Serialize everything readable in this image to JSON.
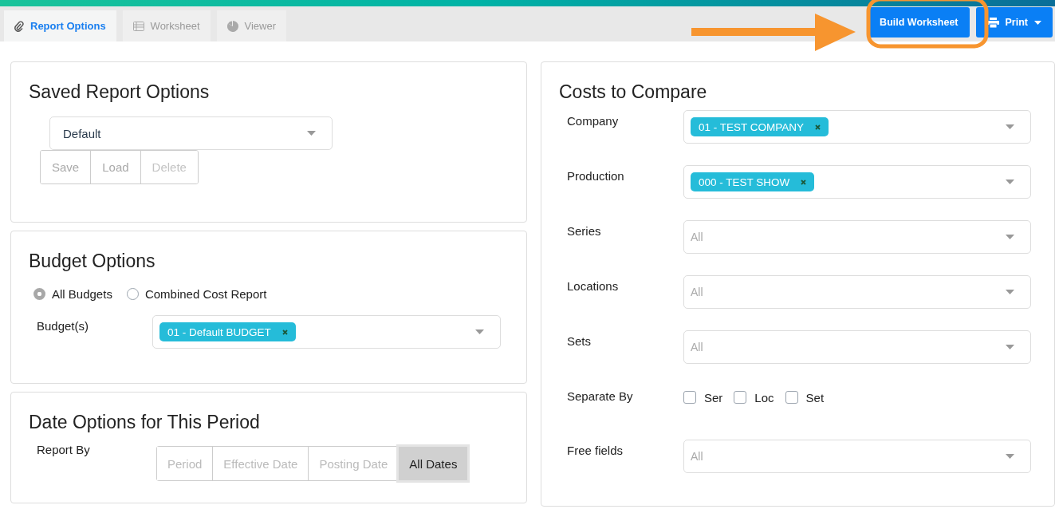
{
  "tabs": [
    {
      "label": "Report Options",
      "selected": true
    },
    {
      "label": "Worksheet",
      "selected": false
    },
    {
      "label": "Viewer",
      "selected": false
    }
  ],
  "toolbar": {
    "build_button": "Build Worksheet",
    "print_button": "Print"
  },
  "saved_report_options": {
    "title": "Saved Report Options",
    "select_value": "Default",
    "buttons": [
      {
        "label": "Save",
        "disabled": false
      },
      {
        "label": "Load",
        "disabled": false
      },
      {
        "label": "Delete",
        "disabled": true
      }
    ]
  },
  "budget_options": {
    "title": "Budget Options",
    "radios": [
      {
        "label": "All Budgets",
        "selected": true
      },
      {
        "label": "Combined Cost Report",
        "selected": false
      }
    ],
    "field": {
      "label": "Budget(s)",
      "tags": [
        "01 - Default BUDGET"
      ]
    }
  },
  "date_options": {
    "title": "Date Options for This Period",
    "field": {
      "label": "Report By",
      "segments": [
        {
          "label": "Period",
          "selected": false
        },
        {
          "label": "Effective Date",
          "selected": false
        },
        {
          "label": "Posting Date",
          "selected": false
        },
        {
          "label": "All Dates",
          "selected": true
        }
      ]
    }
  },
  "costs_to_compare": {
    "title": "Costs to Compare",
    "fields": [
      {
        "kind": "select",
        "label": "Company",
        "tags": [
          "01 - TEST COMPANY"
        ]
      },
      {
        "kind": "select",
        "label": "Production",
        "tags": [
          "000 - TEST SHOW"
        ]
      },
      {
        "kind": "select",
        "label": "Series",
        "placeholder": "All"
      },
      {
        "kind": "select",
        "label": "Locations",
        "placeholder": "All"
      },
      {
        "kind": "select",
        "label": "Sets",
        "placeholder": "All"
      },
      {
        "kind": "checkboxes",
        "label": "Separate By",
        "options": [
          {
            "label": "Ser",
            "checked": false
          },
          {
            "label": "Loc",
            "checked": false
          },
          {
            "label": "Set",
            "checked": false
          }
        ]
      },
      {
        "kind": "select",
        "label": "Free fields",
        "placeholder": "All"
      }
    ]
  }
}
